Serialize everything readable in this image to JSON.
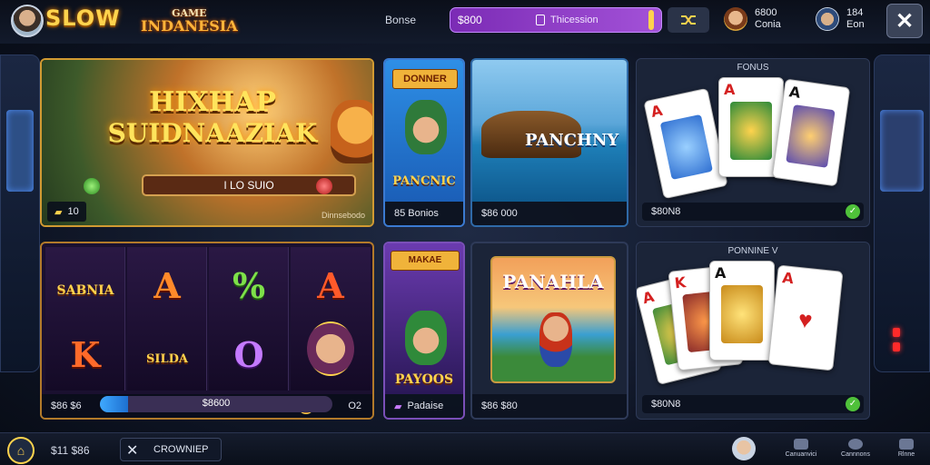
{
  "header": {
    "logo_text": "SLOW",
    "brand_line1": "GAME",
    "brand_line2": "INDANESIA",
    "nav_label": "Bonse",
    "balance_amount": "$800",
    "promo_label": "Thicession",
    "coins_value": "6800",
    "coins_label": "Conia",
    "level_value": "184",
    "level_label": "Eon",
    "close_symbol": "✕"
  },
  "games": {
    "featured": {
      "title_line1": "HIXHAP",
      "title_line2": "SUIDNAAZIAK",
      "play_label": "I LO SUIO",
      "footer_left": "10",
      "footer_right": "Dinnsebodo"
    },
    "small1": {
      "title": "PANCNIC",
      "banner": "DONNER",
      "footer": "85 Bonios"
    },
    "ship": {
      "title": "PANCHNY",
      "footer": "$86 000"
    },
    "deck1": {
      "label": "FONUS",
      "footer": "$80N8",
      "cards": [
        "A",
        "A",
        "A"
      ]
    },
    "slots": {
      "symbols": [
        "SABNIA",
        "A",
        "%",
        "A",
        "K",
        "SILDA",
        "O"
      ],
      "footer_left": "$86 $6",
      "progress_label": "$8600",
      "progress_value": 0.12,
      "footer_right": "O2"
    },
    "small2": {
      "title": "PAYOOS",
      "banner": "MAKAE",
      "footer": "Padaise"
    },
    "panahla": {
      "title": "PANAHLA",
      "footer": "$86 $80"
    },
    "deck2": {
      "label": "PONNINE V",
      "footer": "$80N8",
      "cards": [
        "A",
        "K",
        "A",
        "A"
      ]
    }
  },
  "bottom": {
    "stat": "$11 $86",
    "mode_label": "CROWNIEP",
    "nav_items": [
      "Canuanvici",
      "Cannnons",
      "Rlnne"
    ]
  },
  "colors": {
    "accent_gold": "#ffd34d",
    "balance_purple": "#8e3ec9",
    "ok_green": "#4fc13a"
  }
}
